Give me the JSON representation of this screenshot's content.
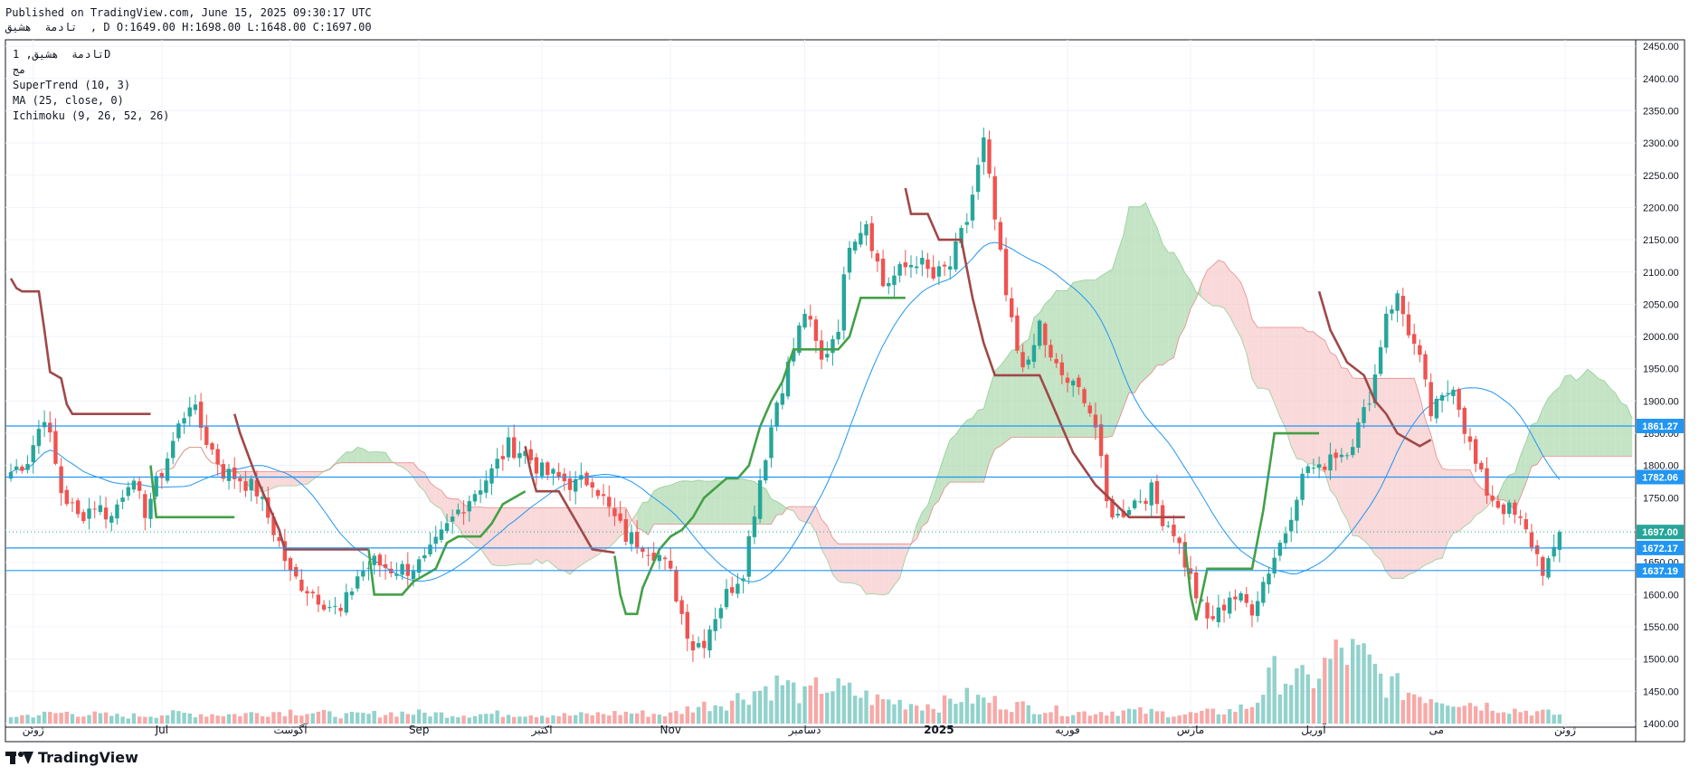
{
  "header": {
    "published": "Published on TradingView.com, June 15, 2025 09:30:17 UTC",
    "ohlc": "تادمة  هشيق  , D O:1649.00 H:1698.00 L:1648.00 C:1697.00"
  },
  "legend": {
    "symbol": "تادمة  هشيق, 1D",
    "exchange": "مج",
    "supertrend": "SuperTrend (10, 3)",
    "ma": "MA (25, close, 0)",
    "ichimoku": "Ichimoku (9, 26, 52, 26)"
  },
  "footer": {
    "brand": "TradingView"
  },
  "colors": {
    "up": "#26a69a",
    "down": "#ef5350",
    "st_up": "#43a047",
    "st_down": "#a04848",
    "ma": "#2196f3",
    "hline": "#2196f3",
    "cloud_bull": "#a5d6a7",
    "cloud_bear": "#f7c6c6"
  },
  "chart_data": {
    "type": "candlestick",
    "ylim": [
      1400,
      2460
    ],
    "y_ticks": [
      1400,
      1450,
      1500,
      1550,
      1600,
      1650,
      1700,
      1750,
      1800,
      1850,
      1900,
      1950,
      2000,
      2050,
      2100,
      2150,
      2200,
      2250,
      2300,
      2350,
      2400,
      2450
    ],
    "x_labels": [
      {
        "i": 4,
        "label": "ژوئن",
        "bold": false
      },
      {
        "i": 27,
        "label": "Jul",
        "bold": false
      },
      {
        "i": 50,
        "label": "آگوست",
        "bold": false
      },
      {
        "i": 73,
        "label": "Sep",
        "bold": false
      },
      {
        "i": 95,
        "label": "اکتبر",
        "bold": false
      },
      {
        "i": 118,
        "label": "Nov",
        "bold": false
      },
      {
        "i": 142,
        "label": "دسامبر",
        "bold": false
      },
      {
        "i": 166,
        "label": "2025",
        "bold": true
      },
      {
        "i": 189,
        "label": "فوریه",
        "bold": false
      },
      {
        "i": 211,
        "label": "مارس",
        "bold": false
      },
      {
        "i": 233,
        "label": "آوریل",
        "bold": false
      },
      {
        "i": 255,
        "label": "می",
        "bold": false
      },
      {
        "i": 278,
        "label": "ژوئن",
        "bold": false
      }
    ],
    "horizontal_lines": [
      1861.27,
      1782.06,
      1672.17,
      1637.19
    ],
    "last_price": 1697.0,
    "price_tags": [
      {
        "value": 1861.27,
        "label": "1861.27",
        "color": "#2196f3"
      },
      {
        "value": 1782.06,
        "label": "1782.06",
        "color": "#2196f3"
      },
      {
        "value": 1697.0,
        "label": "1697.00",
        "color": "#26a69a"
      },
      {
        "value": 1672.17,
        "label": "1672.17",
        "color": "#2196f3"
      },
      {
        "value": 1637.19,
        "label": "1637.19",
        "color": "#2196f3"
      }
    ],
    "close_knots": [
      [
        0,
        1790
      ],
      [
        3,
        1810
      ],
      [
        6,
        1880
      ],
      [
        9,
        1760
      ],
      [
        12,
        1720
      ],
      [
        15,
        1740
      ],
      [
        18,
        1720
      ],
      [
        21,
        1780
      ],
      [
        24,
        1730
      ],
      [
        27,
        1790
      ],
      [
        30,
        1860
      ],
      [
        32,
        1900
      ],
      [
        35,
        1840
      ],
      [
        38,
        1790
      ],
      [
        41,
        1780
      ],
      [
        44,
        1760
      ],
      [
        46,
        1720
      ],
      [
        48,
        1680
      ],
      [
        50,
        1630
      ],
      [
        53,
        1610
      ],
      [
        56,
        1590
      ],
      [
        59,
        1570
      ],
      [
        62,
        1630
      ],
      [
        65,
        1650
      ],
      [
        68,
        1640
      ],
      [
        71,
        1640
      ],
      [
        74,
        1650
      ],
      [
        77,
        1690
      ],
      [
        80,
        1730
      ],
      [
        83,
        1760
      ],
      [
        86,
        1790
      ],
      [
        89,
        1830
      ],
      [
        92,
        1820
      ],
      [
        95,
        1790
      ],
      [
        98,
        1780
      ],
      [
        101,
        1770
      ],
      [
        104,
        1780
      ],
      [
        107,
        1730
      ],
      [
        110,
        1690
      ],
      [
        113,
        1680
      ],
      [
        116,
        1660
      ],
      [
        118,
        1630
      ],
      [
        120,
        1570
      ],
      [
        122,
        1520
      ],
      [
        124,
        1530
      ],
      [
        126,
        1570
      ],
      [
        128,
        1600
      ],
      [
        131,
        1640
      ],
      [
        134,
        1780
      ],
      [
        137,
        1900
      ],
      [
        140,
        1980
      ],
      [
        142,
        2040
      ],
      [
        145,
        1960
      ],
      [
        148,
        2020
      ],
      [
        150,
        2150
      ],
      [
        153,
        2180
      ],
      [
        156,
        2080
      ],
      [
        159,
        2100
      ],
      [
        162,
        2120
      ],
      [
        165,
        2090
      ],
      [
        168,
        2110
      ],
      [
        171,
        2180
      ],
      [
        174,
        2300
      ],
      [
        176,
        2180
      ],
      [
        178,
        2060
      ],
      [
        180,
        1980
      ],
      [
        182,
        1950
      ],
      [
        184,
        2020
      ],
      [
        186,
        1960
      ],
      [
        188,
        1940
      ],
      [
        190,
        1920
      ],
      [
        192,
        1910
      ],
      [
        194,
        1860
      ],
      [
        196,
        1740
      ],
      [
        198,
        1720
      ],
      [
        200,
        1740
      ],
      [
        202,
        1750
      ],
      [
        204,
        1760
      ],
      [
        206,
        1720
      ],
      [
        208,
        1700
      ],
      [
        210,
        1650
      ],
      [
        212,
        1600
      ],
      [
        214,
        1560
      ],
      [
        216,
        1570
      ],
      [
        218,
        1600
      ],
      [
        220,
        1590
      ],
      [
        222,
        1580
      ],
      [
        224,
        1620
      ],
      [
        226,
        1660
      ],
      [
        228,
        1700
      ],
      [
        230,
        1760
      ],
      [
        232,
        1800
      ],
      [
        234,
        1790
      ],
      [
        236,
        1820
      ],
      [
        238,
        1820
      ],
      [
        240,
        1840
      ],
      [
        242,
        1880
      ],
      [
        244,
        1940
      ],
      [
        246,
        2040
      ],
      [
        248,
        2060
      ],
      [
        250,
        2010
      ],
      [
        252,
        1960
      ],
      [
        254,
        1880
      ],
      [
        256,
        1900
      ],
      [
        258,
        1930
      ],
      [
        260,
        1860
      ],
      [
        262,
        1800
      ],
      [
        264,
        1760
      ],
      [
        266,
        1740
      ],
      [
        268,
        1730
      ],
      [
        270,
        1710
      ],
      [
        272,
        1680
      ],
      [
        274,
        1640
      ],
      [
        276,
        1660
      ],
      [
        277,
        1697
      ]
    ],
    "supertrend_segments": [
      {
        "trend": "down",
        "knots": [
          [
            0,
            2090
          ],
          [
            1,
            2075
          ],
          [
            2,
            2070
          ],
          [
            5,
            2070
          ],
          [
            6,
            2010
          ],
          [
            7,
            1945
          ],
          [
            9,
            1935
          ],
          [
            10,
            1895
          ],
          [
            11,
            1880
          ],
          [
            25,
            1880
          ]
        ]
      },
      {
        "trend": "up",
        "knots": [
          [
            25,
            1800
          ],
          [
            26,
            1720
          ],
          [
            40,
            1720
          ]
        ]
      },
      {
        "trend": "down",
        "knots": [
          [
            40,
            1880
          ],
          [
            41,
            1850
          ],
          [
            44,
            1780
          ],
          [
            48,
            1700
          ],
          [
            49,
            1670
          ],
          [
            64,
            1670
          ]
        ]
      },
      {
        "trend": "up",
        "knots": [
          [
            64,
            1670
          ],
          [
            65,
            1600
          ],
          [
            70,
            1600
          ],
          [
            72,
            1620
          ],
          [
            76,
            1640
          ],
          [
            78,
            1680
          ],
          [
            80,
            1690
          ],
          [
            84,
            1690
          ],
          [
            86,
            1710
          ],
          [
            88,
            1740
          ],
          [
            90,
            1750
          ],
          [
            92,
            1760
          ]
        ]
      },
      {
        "trend": "down",
        "knots": [
          [
            92,
            1830
          ],
          [
            93,
            1790
          ],
          [
            94,
            1760
          ],
          [
            98,
            1760
          ],
          [
            100,
            1730
          ],
          [
            102,
            1700
          ],
          [
            104,
            1670
          ],
          [
            108,
            1665
          ]
        ]
      },
      {
        "trend": "up",
        "knots": [
          [
            108,
            1660
          ],
          [
            109,
            1600
          ],
          [
            110,
            1570
          ],
          [
            112,
            1570
          ],
          [
            113,
            1610
          ],
          [
            116,
            1670
          ],
          [
            118,
            1690
          ],
          [
            120,
            1700
          ],
          [
            122,
            1720
          ],
          [
            124,
            1750
          ],
          [
            128,
            1780
          ],
          [
            130,
            1780
          ],
          [
            132,
            1800
          ],
          [
            134,
            1860
          ],
          [
            136,
            1900
          ],
          [
            138,
            1930
          ],
          [
            140,
            1980
          ],
          [
            148,
            1980
          ],
          [
            150,
            2000
          ],
          [
            152,
            2060
          ],
          [
            160,
            2060
          ]
        ]
      },
      {
        "trend": "down",
        "knots": [
          [
            160,
            2230
          ],
          [
            161,
            2190
          ],
          [
            164,
            2190
          ],
          [
            166,
            2150
          ],
          [
            170,
            2150
          ],
          [
            172,
            2060
          ],
          [
            174,
            1990
          ],
          [
            176,
            1940
          ],
          [
            184,
            1940
          ],
          [
            186,
            1900
          ],
          [
            188,
            1860
          ],
          [
            190,
            1820
          ],
          [
            194,
            1770
          ],
          [
            200,
            1720
          ],
          [
            210,
            1720
          ]
        ]
      },
      {
        "trend": "up",
        "knots": [
          [
            210,
            1680
          ],
          [
            211,
            1600
          ],
          [
            212,
            1560
          ],
          [
            214,
            1640
          ],
          [
            222,
            1640
          ],
          [
            224,
            1730
          ],
          [
            226,
            1850
          ],
          [
            234,
            1850
          ]
        ]
      },
      {
        "trend": "down",
        "knots": [
          [
            234,
            2070
          ],
          [
            236,
            2010
          ],
          [
            239,
            1960
          ],
          [
            242,
            1940
          ],
          [
            244,
            1900
          ],
          [
            246,
            1880
          ],
          [
            248,
            1850
          ],
          [
            250,
            1840
          ],
          [
            252,
            1830
          ],
          [
            254,
            1840
          ]
        ]
      }
    ],
    "volume_knots": [
      [
        0,
        8
      ],
      [
        10,
        12
      ],
      [
        20,
        8
      ],
      [
        30,
        11
      ],
      [
        40,
        10
      ],
      [
        50,
        14
      ],
      [
        60,
        9
      ],
      [
        70,
        12
      ],
      [
        80,
        10
      ],
      [
        90,
        11
      ],
      [
        100,
        9
      ],
      [
        110,
        12
      ],
      [
        118,
        10
      ],
      [
        122,
        18
      ],
      [
        128,
        24
      ],
      [
        134,
        38
      ],
      [
        138,
        45
      ],
      [
        142,
        30
      ],
      [
        145,
        42
      ],
      [
        150,
        35
      ],
      [
        155,
        26
      ],
      [
        162,
        22
      ],
      [
        166,
        20
      ],
      [
        170,
        30
      ],
      [
        175,
        25
      ],
      [
        182,
        18
      ],
      [
        190,
        12
      ],
      [
        200,
        14
      ],
      [
        210,
        10
      ],
      [
        218,
        14
      ],
      [
        222,
        20
      ],
      [
        226,
        55
      ],
      [
        232,
        45
      ],
      [
        238,
        80
      ],
      [
        242,
        70
      ],
      [
        246,
        45
      ],
      [
        250,
        35
      ],
      [
        256,
        28
      ],
      [
        262,
        22
      ],
      [
        268,
        16
      ],
      [
        274,
        12
      ],
      [
        277,
        10
      ]
    ]
  }
}
